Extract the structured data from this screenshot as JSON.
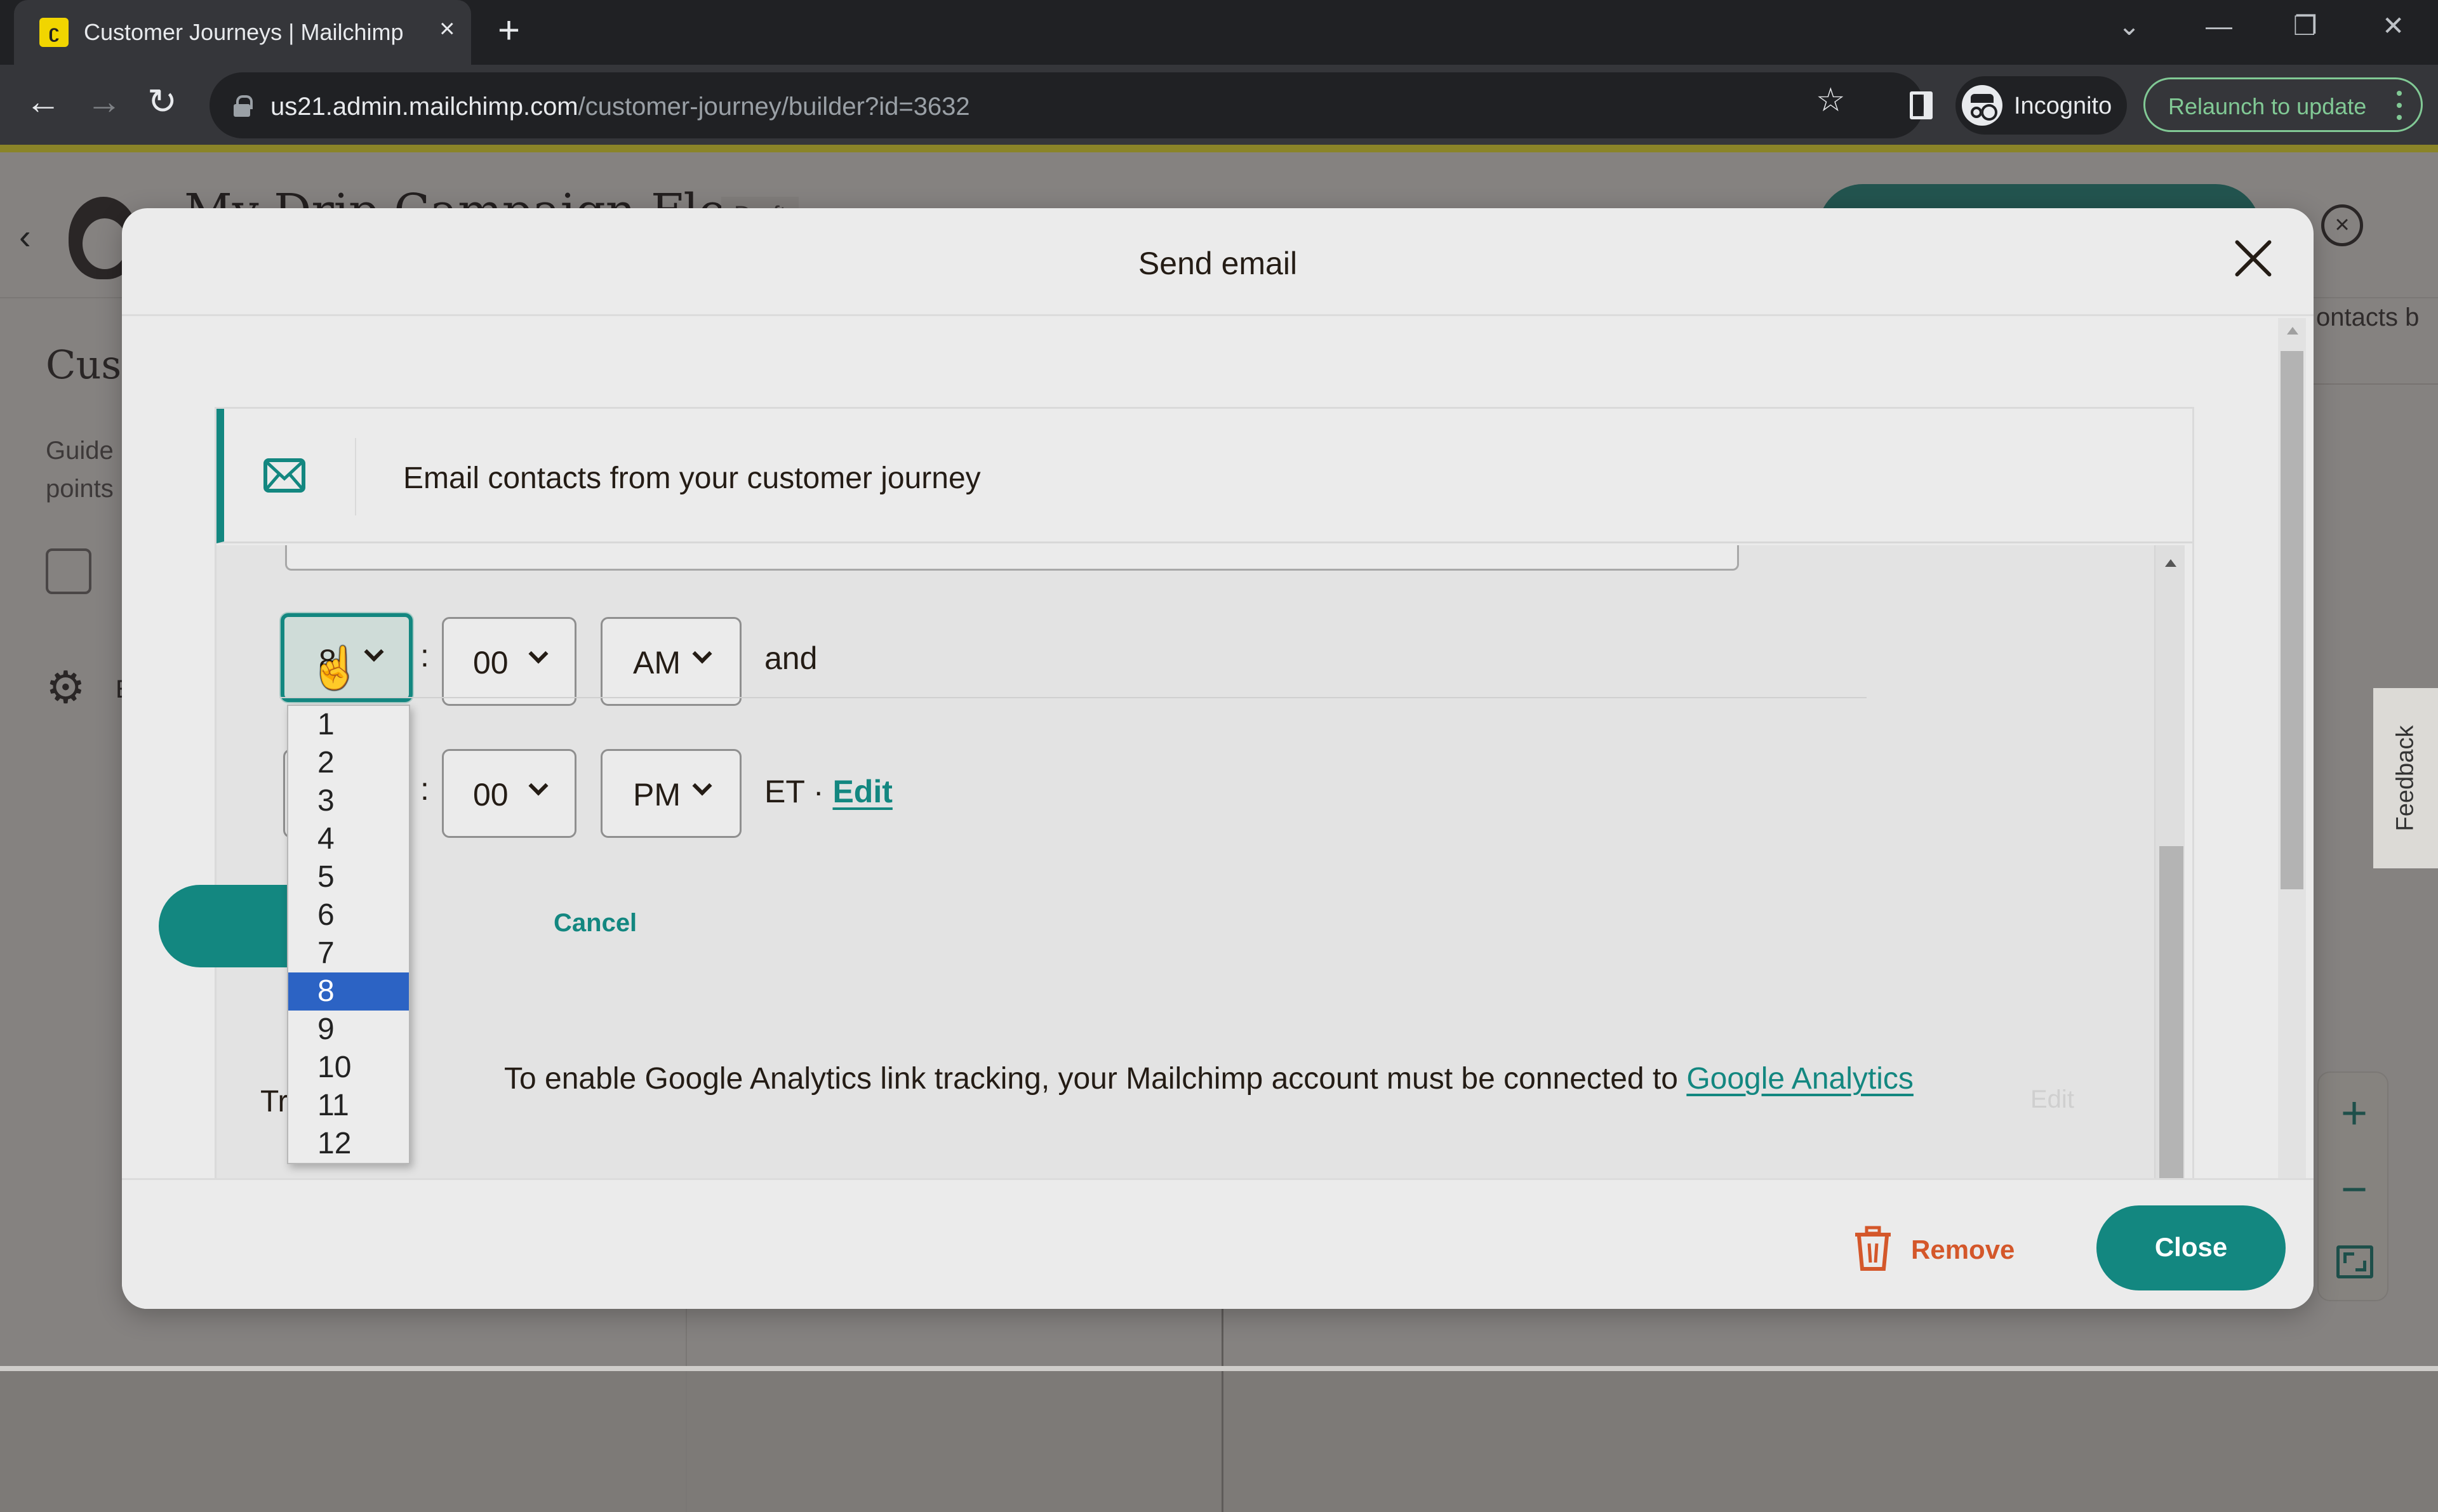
{
  "browser": {
    "tab": {
      "title": "Customer Journeys | Mailchimp",
      "favicon": "mailchimp-favicon",
      "close_glyph": "×"
    },
    "new_tab_glyph": "+",
    "window_controls": {
      "tab_search": "⌄",
      "minimize": "—",
      "restore": "❐",
      "close": "✕"
    },
    "nav": {
      "back": "←",
      "forward": "→",
      "reload": "↻"
    },
    "url_host": "us21.admin.mailchimp.com",
    "url_path": "/customer-journey/builder?id=3632",
    "bookmark_glyph": "☆",
    "incognito_label": "Incognito",
    "relaunch_label": "Relaunch to update"
  },
  "app": {
    "back_glyph": "‹",
    "title": "My Drip Campaign Flow",
    "status_badge": "Draft",
    "close_glyph": "×",
    "sidebar": {
      "heading": "Cust",
      "text_line1": "Guide",
      "text_line2": "points",
      "settings_glyph": "⚙",
      "settings_label_partial": "E"
    },
    "right_panel_text": "ontacts b",
    "feedback_label": "Feedback",
    "zoom_controls": {
      "zoom_in": "+",
      "zoom_out": "−"
    }
  },
  "modal": {
    "title": "Send email",
    "card": {
      "title": "Email contacts from your customer journey"
    },
    "schedule": {
      "start": {
        "hour": "8",
        "minute": "00",
        "period": "AM",
        "suffix": "and"
      },
      "end": {
        "minute": "00",
        "period": "PM",
        "timezone": "ET ·",
        "edit_link": "Edit"
      },
      "colon": ":"
    },
    "hour_options": [
      "1",
      "2",
      "3",
      "4",
      "5",
      "6",
      "7",
      "8",
      "9",
      "10",
      "11",
      "12"
    ],
    "hour_selected": "8",
    "cancel_label": "Cancel",
    "tracking_label_partial": "Tr",
    "ga_notice": {
      "text": "To enable Google Analytics link tracking, your Mailchimp account must be connected to ",
      "link": "Google Analytics"
    },
    "ga_edit_label": "Edit",
    "footer": {
      "remove_label": "Remove",
      "close_label": "Close"
    }
  },
  "colors": {
    "accent_teal": "#138780",
    "remove_orange": "#d4572a",
    "dropdown_selected": "#2c63c4",
    "relaunch_green": "#81c995"
  }
}
